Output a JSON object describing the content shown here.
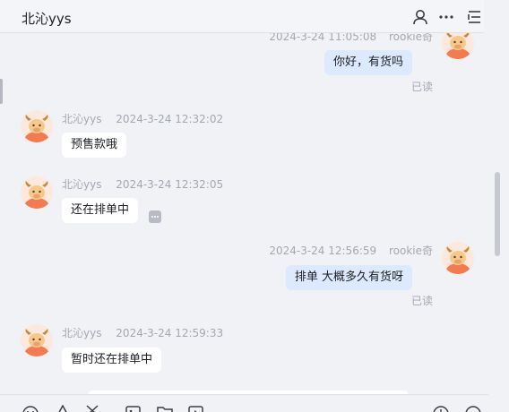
{
  "header": {
    "title": "北沁yys",
    "icons": [
      "user-icon",
      "more-icon",
      "list-icon"
    ]
  },
  "messages": [
    {
      "id": "m1",
      "side": "out",
      "sender": "rookie奇",
      "time": "2024-3-24 11:05:08",
      "text": "你好，有货吗",
      "status": "已读"
    },
    {
      "id": "m2",
      "side": "in",
      "sender": "北沁yys",
      "time": "2024-3-24 12:32:02",
      "text": "预售款哦"
    },
    {
      "id": "m3",
      "side": "in",
      "sender": "北沁yys",
      "time": "2024-3-24 12:32:05",
      "text": "还在排单中"
    },
    {
      "id": "m4",
      "side": "out",
      "sender": "rookie奇",
      "time": "2024-3-24 12:56:59",
      "text": "排单 大概多久有货呀",
      "status": "已读"
    },
    {
      "id": "m5",
      "side": "in",
      "sender": "北沁yys",
      "time": "2024-3-24 12:59:33",
      "text": "暂时还在排单中"
    }
  ],
  "toolbar": {
    "left_icons": [
      "emoji-icon",
      "font-icon",
      "scissors-icon",
      "image-icon",
      "folder-icon",
      "screen-icon"
    ],
    "right_icons": [
      "add-icon",
      "history-icon"
    ]
  },
  "colors": {
    "background": "#f1f2f6",
    "incoming_bubble": "#ffffff",
    "outgoing_bubble": "#dde9ff",
    "meta_text": "#a3a7b0",
    "avatar_orange": "#f47a4f"
  }
}
